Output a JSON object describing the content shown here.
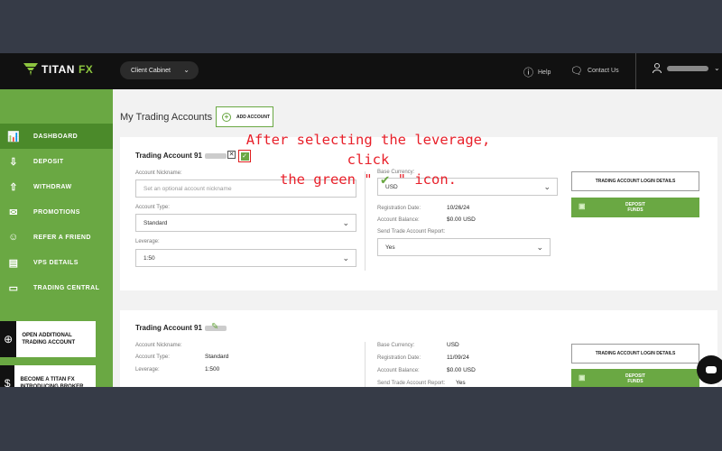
{
  "topbar": {
    "logo_main": "TITAN",
    "logo_accent": "FX",
    "cabinet_label": "Client Cabinet",
    "help_label": "Help",
    "contact_label": "Contact Us"
  },
  "sidebar": {
    "items": [
      {
        "label": "DASHBOARD",
        "icon": "bar-chart-icon",
        "active": true
      },
      {
        "label": "DEPOSIT",
        "icon": "deposit-icon"
      },
      {
        "label": "WITHDRAW",
        "icon": "withdraw-icon"
      },
      {
        "label": "PROMOTIONS",
        "icon": "promotions-icon"
      },
      {
        "label": "REFER A FRIEND",
        "icon": "refer-friend-icon"
      },
      {
        "label": "VPS DETAILS",
        "icon": "server-icon"
      },
      {
        "label": "TRADING CENTRAL",
        "icon": "monitor-icon"
      }
    ],
    "promo1": "OPEN ADDITIONAL TRADING ACCOUNT",
    "promo2": "BECOME A TITAN FX INTRODUCING BROKER"
  },
  "main": {
    "page_title": "My Trading Accounts",
    "add_account": "ADD ACCOUNT"
  },
  "account1": {
    "title": "Trading Account 91",
    "nickname_label": "Account Nickname:",
    "nickname_placeholder": "Set an optional account nickname",
    "type_label": "Account Type:",
    "type_value": "Standard",
    "leverage_label": "Leverage:",
    "leverage_value": "1:50",
    "currency_label": "Base Currency:",
    "currency_value": "USD",
    "regdate_label": "Registration Date:",
    "regdate_value": "10/26/24",
    "balance_label": "Account Balance:",
    "balance_value": "$0.00 USD",
    "report_label": "Send Trade Account Report:",
    "report_value": "Yes",
    "login_btn": "TRADING ACCOUNT LOGIN DETAILS",
    "deposit_btn": "DEPOSIT FUNDS"
  },
  "account2": {
    "title": "Trading Account 91",
    "nickname_label": "Account Nickname:",
    "type_label": "Account Type:",
    "type_value": "Standard",
    "leverage_label": "Leverage:",
    "leverage_value": "1:500",
    "currency_label": "Base Currency:",
    "currency_value": "USD",
    "regdate_label": "Registration Date:",
    "regdate_value": "11/09/24",
    "balance_label": "Account Balance:",
    "balance_value": "$0.00 USD",
    "report_label": "Send Trade Account Report:",
    "report_value": "Yes",
    "login_btn": "TRADING ACCOUNT LOGIN DETAILS",
    "deposit_btn": "DEPOSIT FUNDS"
  },
  "annotation": {
    "line1": "After selecting the leverage, click",
    "line2a": "the green \"",
    "check": "✔",
    "line2b": "\" icon."
  },
  "colors": {
    "brand_green": "#6aa843",
    "annotation_red": "#e8202a"
  }
}
